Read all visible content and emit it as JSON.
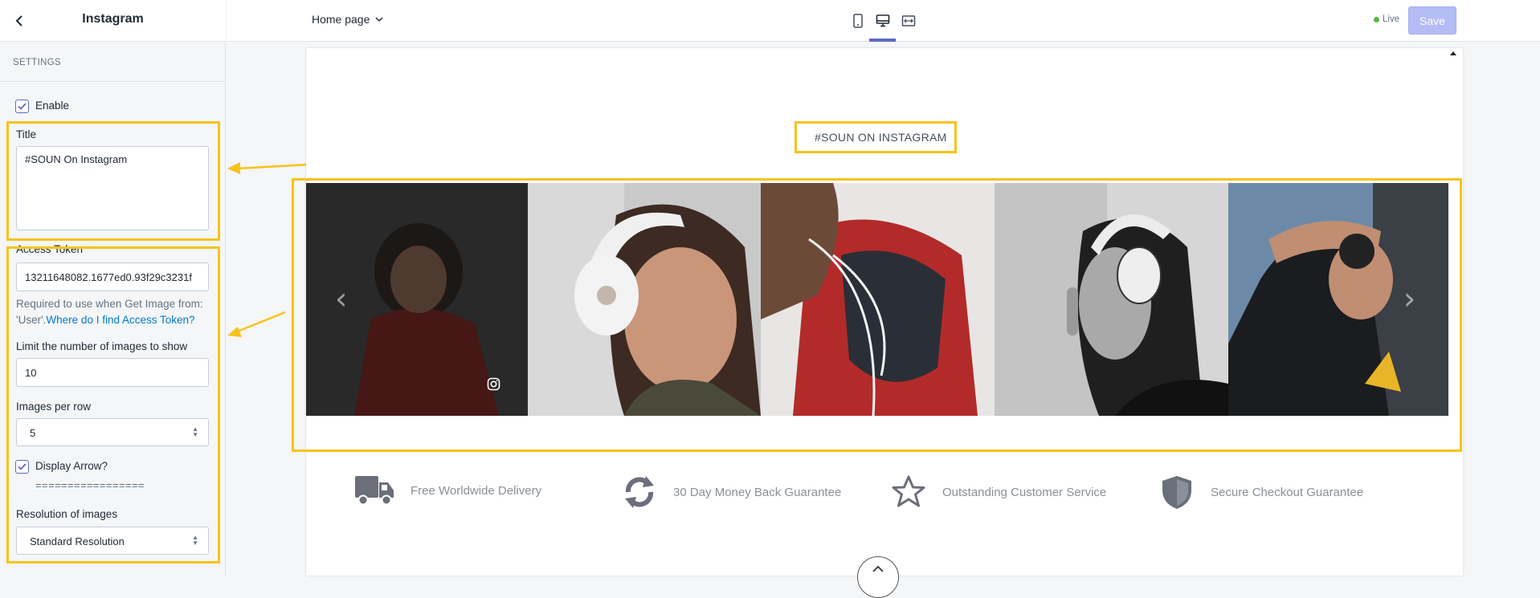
{
  "sidebar": {
    "title": "Instagram",
    "section_label": "SETTINGS",
    "enable_label": "Enable",
    "title_field_label": "Title",
    "title_field_value": "#SOUN On Instagram",
    "access_token_label": "Access Token",
    "access_token_value": "13211648082.1677ed0.93f29c3231f",
    "help_text": "Required to use when Get Image from: 'User'.",
    "help_link": "Where do I find Access Token?",
    "limit_label": "Limit the number of images to show",
    "limit_value": "10",
    "per_row_label": "Images per row",
    "per_row_value": "5",
    "display_arrow_label": "Display Arrow?",
    "separator": "=================",
    "resolution_label": "Resolution of images",
    "resolution_value": "Standard Resolution"
  },
  "topbar": {
    "page_select": "Home page",
    "live_label": "Live",
    "save_label": "Save"
  },
  "preview": {
    "instagram_title": "#SOUN ON INSTAGRAM",
    "features": [
      {
        "icon": "truck-icon",
        "text": "Free Worldwide Delivery"
      },
      {
        "icon": "refresh-icon",
        "text": "30 Day Money Back Guarantee"
      },
      {
        "icon": "star-icon",
        "text": "Outstanding Customer Service"
      },
      {
        "icon": "shield-icon",
        "text": "Secure Checkout Guarantee"
      }
    ]
  },
  "colors": {
    "highlight": "#f7c318",
    "accent": "#5c6ac4",
    "save_button": "#b3bcf5",
    "live_dot": "#50b83c"
  }
}
